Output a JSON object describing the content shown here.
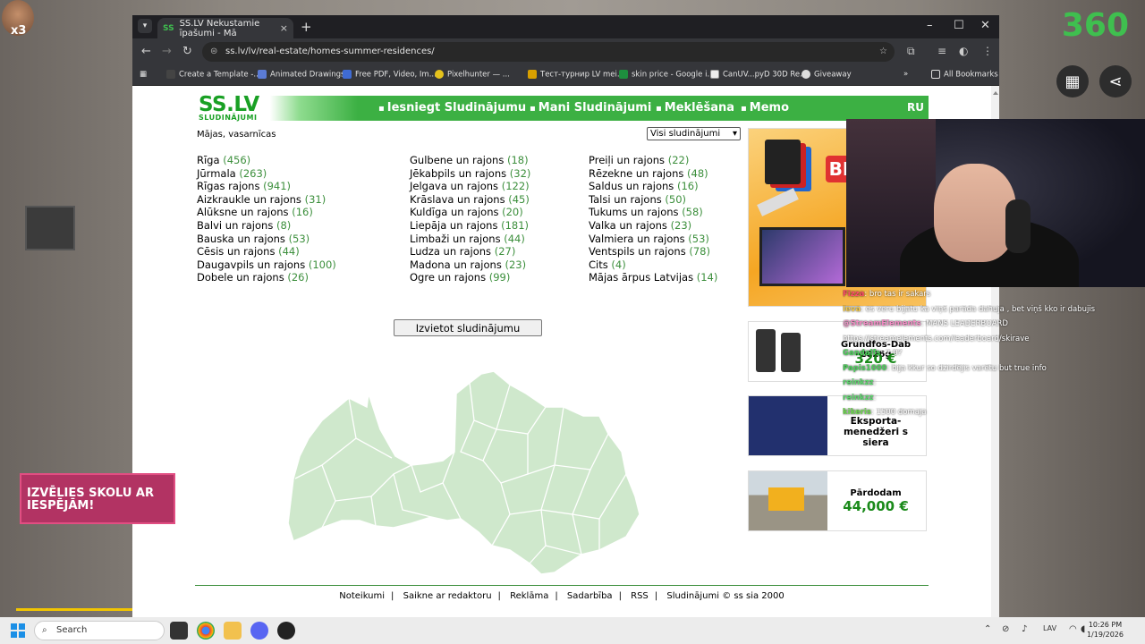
{
  "stream": {
    "badge_count": "x3",
    "logo": "360",
    "school_ad_text": "IZVĒLIES SKOLU AR IESPĒJĀM!"
  },
  "browser": {
    "tab_title": "SS.LV Nekustamie īpašumi - Mā",
    "url": "ss.lv/lv/real-estate/homes-summer-residences/",
    "bookmarks": [
      "Create a Template -...",
      "Animated Drawings",
      "Free PDF, Video, Im...",
      "Pixelhunter — ...",
      "Тест-турнир LV mei...",
      "skin price - Google i...",
      "CanUV...pyD 30D Re...",
      "Giveaway"
    ],
    "all_bookmarks": "All Bookmarks"
  },
  "site": {
    "logo": "SS.LV",
    "logo_sub": "SLUDINĀJUMI",
    "nav": [
      "Iesniegt Sludinājumu",
      "Mani Sludinājumi",
      "Meklēšana",
      "Memo"
    ],
    "lang": "RU",
    "breadcrumb": "Mājas, vasarnīcas",
    "filter_value": "Visi sludinājumi",
    "post_button": "Izvietot sludinājumu",
    "regions": [
      [
        {
          "name": "Rīga",
          "count": "(456)"
        },
        {
          "name": "Jūrmala",
          "count": "(263)"
        },
        {
          "name": "Rīgas rajons",
          "count": "(941)"
        },
        {
          "name": "Aizkraukle un rajons",
          "count": "(31)"
        },
        {
          "name": "Alūksne un rajons",
          "count": "(16)"
        },
        {
          "name": "Balvi un rajons",
          "count": "(8)"
        },
        {
          "name": "Bauska un rajons",
          "count": "(53)"
        },
        {
          "name": "Cēsis un rajons",
          "count": "(44)"
        },
        {
          "name": "Daugavpils un rajons",
          "count": "(100)"
        },
        {
          "name": "Dobele un rajons",
          "count": "(26)"
        }
      ],
      [
        {
          "name": "Gulbene un rajons",
          "count": "(18)"
        },
        {
          "name": "Jēkabpils un rajons",
          "count": "(32)"
        },
        {
          "name": "Jelgava un rajons",
          "count": "(122)"
        },
        {
          "name": "Krāslava un rajons",
          "count": "(45)"
        },
        {
          "name": "Kuldīga un rajons",
          "count": "(20)"
        },
        {
          "name": "Liepāja un rajons",
          "count": "(181)"
        },
        {
          "name": "Limbaži un rajons",
          "count": "(44)"
        },
        {
          "name": "Ludza un rajons",
          "count": "(27)"
        },
        {
          "name": "Madona un rajons",
          "count": "(23)"
        },
        {
          "name": "Ogre un rajons",
          "count": "(99)"
        }
      ],
      [
        {
          "name": "Preiļi un rajons",
          "count": "(22)"
        },
        {
          "name": "Rēzekne un rajons",
          "count": "(48)"
        },
        {
          "name": "Saldus un rajons",
          "count": "(16)"
        },
        {
          "name": "Talsi un rajons",
          "count": "(50)"
        },
        {
          "name": "Tukums un rajons",
          "count": "(58)"
        },
        {
          "name": "Valka un rajons",
          "count": "(23)"
        },
        {
          "name": "Valmiera un rajons",
          "count": "(53)"
        },
        {
          "name": "Ventspils un rajons",
          "count": "(78)"
        },
        {
          "name": "Cits",
          "count": "(4)"
        },
        {
          "name": "Mājas ārpus Latvijas",
          "count": "(14)"
        }
      ]
    ],
    "footer": [
      "Noteikumi",
      "Saikne ar redaktoru",
      "Reklāma",
      "Sadarbība",
      "RSS",
      "Sludinājumi © ss sia 2000"
    ],
    "ads": {
      "big_text": "BI",
      "ad2_title": "Grundfos-Dab 2026g",
      "ad2_price": "320 €",
      "ad3_title": "Eksporta-menedžeri s siera",
      "ad4_title": "Pārdodam",
      "ad4_price": "44,000 €"
    }
  },
  "chat": [
    {
      "user": "Fizza",
      "msg": ": bro tas ir sakars"
    },
    {
      "user": "Ieva",
      "msg": ": es veru bijatu ka viņš parāda dahuja , bet viņš kko ir dabujis"
    },
    {
      "user": "@StreamElements",
      "msg": ": MANS LEADERBOARD"
    },
    {
      "user": "",
      "msg": "https://streamelements.com/leaderboard/skirave"
    },
    {
      "user": "Gandalfs",
      "msg": ": 2-0?"
    },
    {
      "user": "Papis1000",
      "msg": ": bija kkur so dzirdējis varētu but true info"
    },
    {
      "user": "reinkzz",
      "msg": ":"
    },
    {
      "user": "reinkzz",
      "msg": ":"
    },
    {
      "user": "kikeris",
      "msg": ": 1500 domaja"
    }
  ],
  "taskbar": {
    "search": "Search",
    "lang": "LAV",
    "time": "10:26 PM",
    "date": "1/19/2026"
  }
}
